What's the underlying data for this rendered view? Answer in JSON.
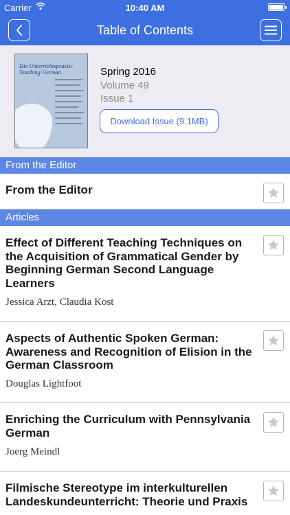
{
  "status_bar": {
    "carrier": "Carrier",
    "time": "10:40 AM"
  },
  "nav": {
    "title": "Table of Contents"
  },
  "issue": {
    "season": "Spring 2016",
    "volume": "Volume 49",
    "number": "Issue 1",
    "download_label": "Download Issue (9.1MB)",
    "cover_title": "Die Unterrichtspraxis/ Teaching German"
  },
  "sections": [
    {
      "header": "From the Editor",
      "items": [
        {
          "title": "From the Editor",
          "authors": ""
        }
      ]
    },
    {
      "header": "Articles",
      "items": [
        {
          "title": "Effect of Different Teaching Techniques on the Acquisition of Grammatical Gender by Beginning German Second Language Learners",
          "authors": "Jessica Arzt, Claudia Kost"
        },
        {
          "title": "Aspects of Authentic Spoken German: Awareness and Recognition of Elision in the German Classroom",
          "authors": "Douglas Lightfoot"
        },
        {
          "title": "Enriching the Curriculum with Pennsylvania German",
          "authors": "Joerg Meindl"
        },
        {
          "title": "Filmische Stereotype im interkulturellen Landeskundeunterricht: Theorie und Praxis",
          "authors": ""
        }
      ]
    }
  ],
  "colors": {
    "brand": "#3d6fe0",
    "section_header": "#5c87e6",
    "header_bg": "#ececf2"
  },
  "icons": {
    "back": "chevron-left-icon",
    "menu": "hamburger-menu-icon",
    "favorite": "star-icon",
    "wifi": "wifi-icon",
    "battery": "battery-icon"
  }
}
